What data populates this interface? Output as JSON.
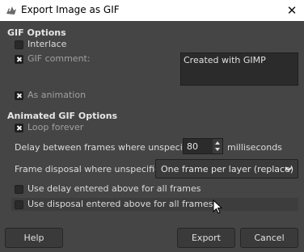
{
  "window": {
    "title": "Export Image as GIF",
    "close_glyph": "✕"
  },
  "gif_options": {
    "heading": "GIF Options",
    "interlace": {
      "label": "Interlace",
      "checked": false
    },
    "gif_comment": {
      "label": "GIF comment:",
      "checked": true,
      "value": "Created with GIMP"
    },
    "as_animation": {
      "label": "As animation",
      "checked": true
    }
  },
  "animated_options": {
    "heading": "Animated GIF Options",
    "loop_forever": {
      "label": "Loop forever",
      "checked": true
    },
    "delay": {
      "label": "Delay between frames where unspecified:",
      "value": "80",
      "unit": "milliseconds"
    },
    "disposal": {
      "label": "Frame disposal where unspecified:",
      "selected": "One frame per layer (replace)"
    },
    "use_delay": {
      "label": "Use delay entered above for all frames",
      "checked": false
    },
    "use_disposal": {
      "label": "Use disposal entered above for all frames",
      "checked": false
    }
  },
  "buttons": {
    "help": "Help",
    "export": "Export",
    "cancel": "Cancel"
  },
  "colors": {
    "dialog_bg": "#454545",
    "titlebar_bg": "#ffffff"
  },
  "icons": {
    "app": "gimp-wilber-icon",
    "close": "close-icon",
    "dropdown": "chevron-down-icon",
    "cursor": "mouse-pointer-icon"
  }
}
